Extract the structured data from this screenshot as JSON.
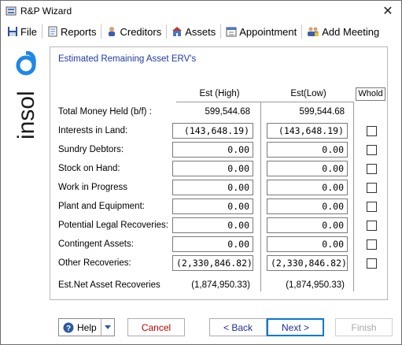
{
  "window": {
    "title": "R&P Wizard",
    "close_glyph": "✕"
  },
  "toolbar": {
    "items": [
      {
        "label": "File",
        "icon": "save-icon"
      },
      {
        "label": "Reports",
        "icon": "reports-icon"
      },
      {
        "label": "Creditors",
        "icon": "creditors-icon"
      },
      {
        "label": "Assets",
        "icon": "assets-icon"
      },
      {
        "label": "Appointment",
        "icon": "appointment-icon"
      },
      {
        "label": "Add Meeting",
        "icon": "add-meeting-icon"
      }
    ]
  },
  "logo": {
    "text": "insol6",
    "color": "#1a1a1a",
    "accent": "#1e88e5"
  },
  "panel": {
    "title": "Estimated Remaining Asset ERV's",
    "col_high": "Est (High)",
    "col_low": "Est(Low)",
    "col_whold": "Whold",
    "total_money": {
      "label": "Total Money Held (b/f) :",
      "high": "599,544.68",
      "low": "599,544.68"
    },
    "rows": [
      {
        "label": "Interests in Land:",
        "high": "(143,648.19)",
        "low": "(143,648.19)",
        "whold": false
      },
      {
        "label": "Sundry Debtors:",
        "high": "0.00",
        "low": "0.00",
        "whold": false
      },
      {
        "label": "Stock on Hand:",
        "high": "0.00",
        "low": "0.00",
        "whold": false
      },
      {
        "label": "Work in Progress",
        "high": "0.00",
        "low": "0.00",
        "whold": false
      },
      {
        "label": "Plant and Equipment:",
        "high": "0.00",
        "low": "0.00",
        "whold": false
      },
      {
        "label": "Potential Legal Recoveries:",
        "high": "0.00",
        "low": "0.00",
        "whold": false
      },
      {
        "label": "Contingent Assets:",
        "high": "0.00",
        "low": "0.00",
        "whold": false
      },
      {
        "label": "Other Recoveries:",
        "high": "(2,330,846.82)",
        "low": "(2,330,846.82)",
        "whold": false
      }
    ],
    "net": {
      "label": "Est.Net Asset Recoveries",
      "high": "(1,874,950.33)",
      "low": "(1,874,950.33)"
    }
  },
  "footer": {
    "help_label": "Help",
    "cancel_label": "Cancel",
    "back_label": "< Back",
    "next_label": "Next >",
    "finish_label": "Finish"
  }
}
